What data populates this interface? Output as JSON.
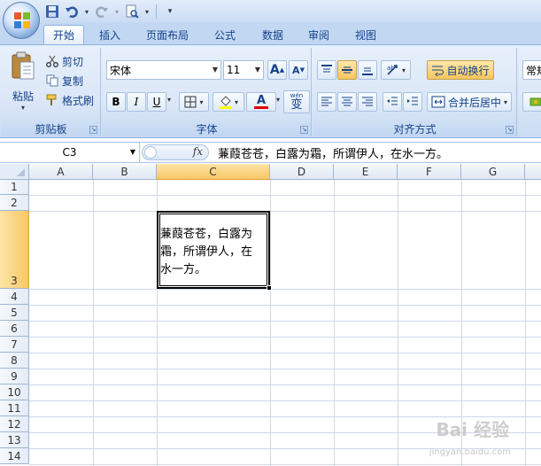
{
  "qat": {
    "office_button": "office-orb",
    "save": "save-icon",
    "undo": "undo-icon",
    "redo": "redo-icon",
    "print_preview": "print-preview-icon",
    "customize": "qat-customize-icon"
  },
  "tabs": [
    {
      "label": "开始",
      "active": true
    },
    {
      "label": "插入"
    },
    {
      "label": "页面布局"
    },
    {
      "label": "公式"
    },
    {
      "label": "数据"
    },
    {
      "label": "审阅"
    },
    {
      "label": "视图"
    }
  ],
  "clipboard": {
    "paste": "粘贴",
    "cut": "剪切",
    "copy": "复制",
    "format_painter": "格式刷",
    "group_label": "剪贴板"
  },
  "font": {
    "name": "宋体",
    "size": "11",
    "grow": "A",
    "shrink": "A",
    "bold": "B",
    "italic": "I",
    "underline": "U",
    "font_color_letter": "A",
    "wen": "wén",
    "bian": "变",
    "group_label": "字体"
  },
  "alignment": {
    "wrap_text": "自动换行",
    "merge_center": "合并后居中",
    "group_label": "对齐方式"
  },
  "number": {
    "format_partial": "常规"
  },
  "formula_bar": {
    "name_box": "C3",
    "fx": "fx",
    "content": "蒹葭苍苍，白露为霜，所谓伊人，在水一方。"
  },
  "columns": [
    "A",
    "B",
    "C",
    "D",
    "E",
    "F",
    "G"
  ],
  "rows": [
    "1",
    "2",
    "3",
    "4",
    "5",
    "6",
    "7",
    "8",
    "9",
    "10",
    "11",
    "12",
    "13",
    "14"
  ],
  "selected_cell": {
    "address": "C3",
    "text": "蒹葭苍苍，白露为霜，所谓伊人，在水一方。",
    "lines": [
      "蒹葭苍苍，白露为",
      "霜，所谓伊人，在",
      "水一方。"
    ]
  },
  "watermark": {
    "main": "Bai 经验",
    "sub": "jingyan.baidu.com"
  },
  "colors": {
    "ribbon": "#dbe7f7",
    "selected_header": "#f8c766",
    "accent": "#15428b"
  }
}
